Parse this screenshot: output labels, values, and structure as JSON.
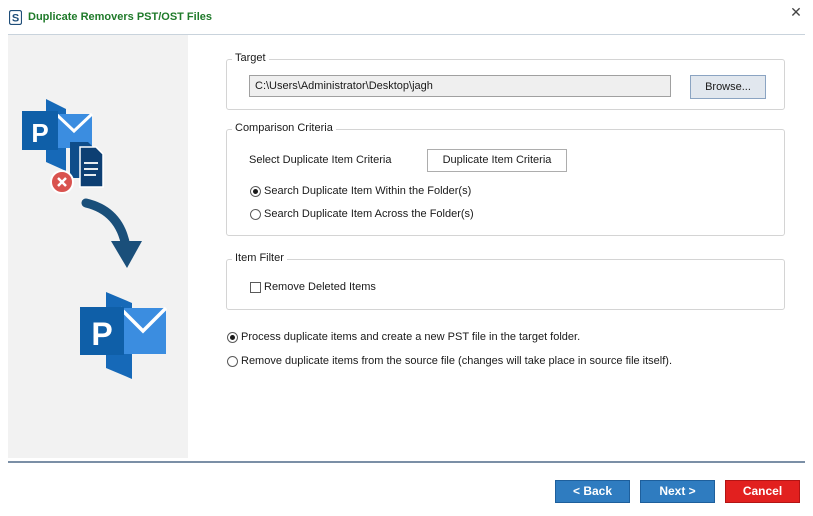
{
  "window": {
    "title": "Duplicate Removers PST/OST Files",
    "close_glyph": "✕"
  },
  "target": {
    "label": "Target",
    "path_value": "C:\\Users\\Administrator\\Desktop\\jagh",
    "browse_label": "Browse..."
  },
  "comparison": {
    "label": "Comparison Criteria",
    "select_label": "Select Duplicate Item Criteria",
    "criteria_button_label": "Duplicate Item Criteria",
    "options": [
      {
        "label": "Search Duplicate Item Within the Folder(s)",
        "selected": true
      },
      {
        "label": "Search Duplicate Item Across the Folder(s)",
        "selected": false
      }
    ]
  },
  "item_filter": {
    "label": "Item Filter",
    "remove_deleted_label": "Remove Deleted Items",
    "remove_deleted_checked": false
  },
  "output_mode": {
    "options": [
      {
        "label": "Process duplicate items and create a new PST file in the target folder.",
        "selected": true
      },
      {
        "label": "Remove duplicate items from the source file (changes will take place in source file itself).",
        "selected": false
      }
    ]
  },
  "footer": {
    "back_label": "< Back",
    "next_label": "Next >",
    "cancel_label": "Cancel"
  },
  "icons": {
    "app_logo": "s-logo-icon",
    "source_pst": "outlook-pst-icon",
    "documents": "documents-icon",
    "error_badge": "error-x-icon",
    "arrow": "curved-arrow-down-icon",
    "result_pst": "outlook-pst-icon"
  },
  "colors": {
    "title_green": "#1f7a2a",
    "outlook_blue": "#0f6cbd",
    "arrow_navy": "#1a4f7a",
    "nav_blue": "#2f7cc0",
    "cancel_red": "#e2201f",
    "error_red": "#d9534f"
  }
}
